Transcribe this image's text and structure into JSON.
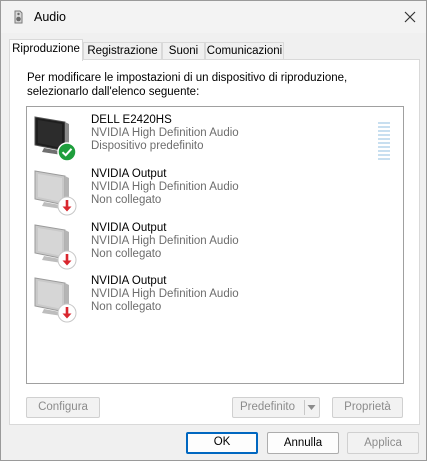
{
  "window": {
    "title": "Audio",
    "icon": "speaker-icon",
    "close_icon": "close-icon"
  },
  "tabs": [
    {
      "label": "Riproduzione",
      "active": true
    },
    {
      "label": "Registrazione",
      "active": false
    },
    {
      "label": "Suoni",
      "active": false
    },
    {
      "label": "Comunicazioni",
      "active": false
    }
  ],
  "instructions": "Per modificare le impostazioni di un dispositivo di riproduzione, selezionarlo dall'elenco seguente:",
  "devices": [
    {
      "name": "DELL E2420HS",
      "driver": "NVIDIA High Definition Audio",
      "status": "Dispositivo predefinito",
      "state": "default"
    },
    {
      "name": "NVIDIA Output",
      "driver": "NVIDIA High Definition Audio",
      "status": "Non collegato",
      "state": "unplugged"
    },
    {
      "name": "NVIDIA Output",
      "driver": "NVIDIA High Definition Audio",
      "status": "Non collegato",
      "state": "unplugged"
    },
    {
      "name": "NVIDIA Output",
      "driver": "NVIDIA High Definition Audio",
      "status": "Non collegato",
      "state": "unplugged"
    }
  ],
  "buttons": {
    "configure": "Configura",
    "set_default": "Predefinito",
    "properties": "Proprietà",
    "ok": "OK",
    "cancel": "Annulla",
    "apply": "Applica"
  },
  "colors": {
    "default_check": "#1e9e3c",
    "unplugged_arrow": "#d9262e",
    "accent": "#0067c0"
  }
}
